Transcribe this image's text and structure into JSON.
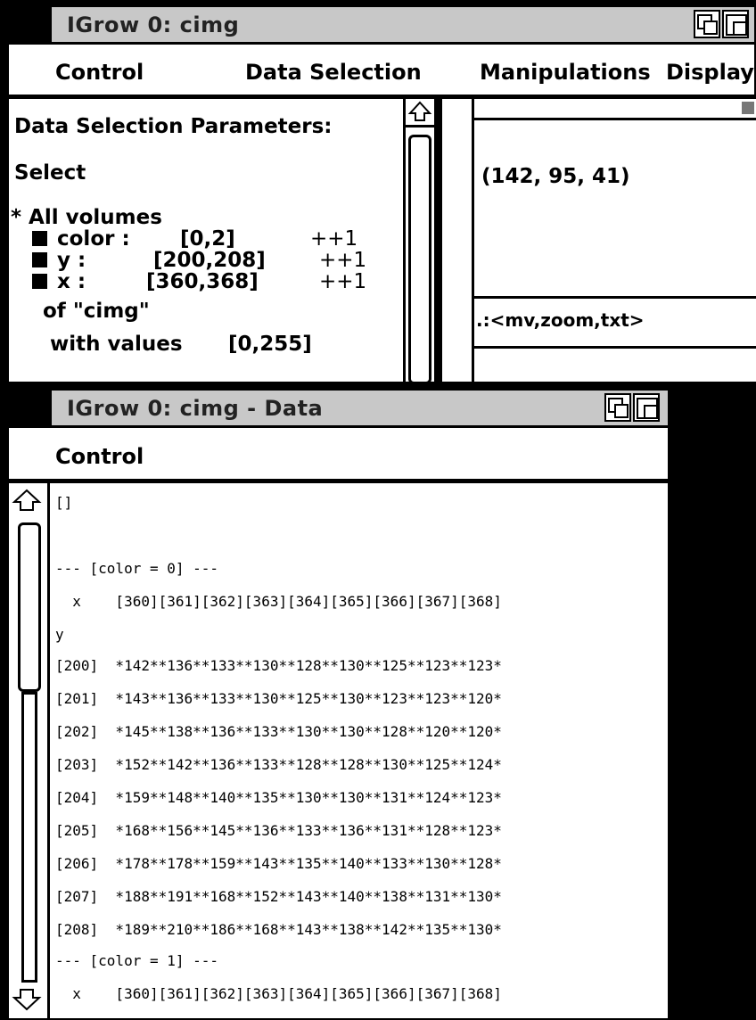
{
  "top_window": {
    "title": "IGrow 0: cimg",
    "menu": [
      "Control",
      "Data Selection",
      "Manipulations",
      "Display"
    ],
    "params": {
      "heading": "Data Selection Parameters:",
      "select_label": "Select",
      "all_volumes": "* All volumes",
      "dims": [
        {
          "name": "color :",
          "range": "[0,2]",
          "step": "++1"
        },
        {
          "name": "y :",
          "range": "[200,208]",
          "step": "++1"
        },
        {
          "name": "x :",
          "range": "[360,368]",
          "step": "++1"
        }
      ],
      "of_label": "of \"cimg\"",
      "with_values_label": "with values",
      "with_values_range": "[0,255]"
    },
    "display": {
      "pixel_readout": "(142, 95, 41)",
      "command_prompt": ".:<mv,zoom,txt>"
    }
  },
  "data_window": {
    "title": "IGrow 0: cimg - Data",
    "menu": [
      "Control"
    ],
    "lines": [
      "[]",
      "",
      "--- [color = 0] ---",
      "  x    [360][361][362][363][364][365][366][367][368]",
      "y",
      "[200]  *142**136**133**130**128**130**125**123**123*",
      "[201]  *143**136**133**130**125**130**123**123**120*",
      "[202]  *145**138**136**133**130**130**128**120**120*",
      "[203]  *152**142**136**133**128**128**130**125**124*",
      "[204]  *159**148**140**135**130**130**131**124**123*",
      "[205]  *168**156**145**136**133**136**131**128**123*",
      "[206]  *178**178**159**143**135**140**133**130**128*",
      "[207]  *188**191**168**152**143**140**138**131**130*",
      "[208]  *189**210**186**168**143**138**142**135**130*",
      "--- [color = 1] ---",
      "  x    [360][361][362][363][364][365][366][367][368]"
    ]
  },
  "icons": {
    "close_box": "black-square",
    "zoom_box": "overlapping-squares",
    "scroll_up": "up-arrow",
    "scroll_down": "down-arrow"
  }
}
